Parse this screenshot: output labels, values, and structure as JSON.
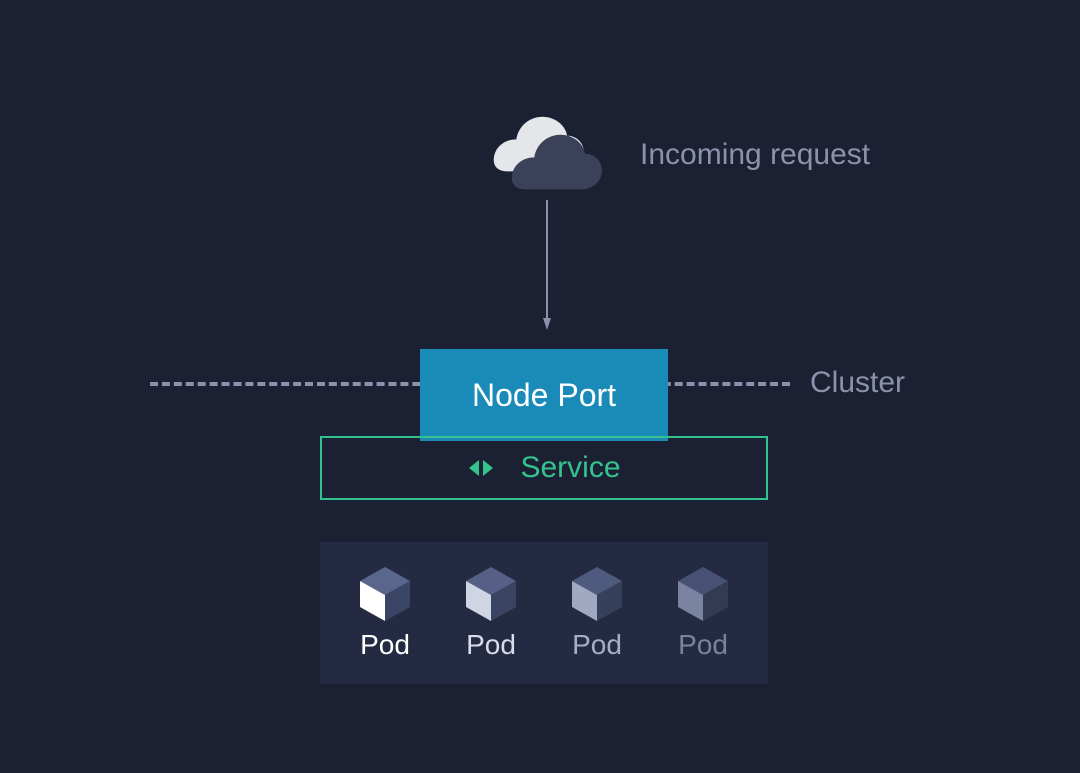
{
  "diagram": {
    "incoming_label": "Incoming request",
    "cluster_label": "Cluster",
    "nodeport_label": "Node Port",
    "service_label": "Service",
    "pods": [
      {
        "label": "Pod",
        "opacity": 1.0
      },
      {
        "label": "Pod",
        "opacity": 0.85
      },
      {
        "label": "Pod",
        "opacity": 0.65
      },
      {
        "label": "Pod",
        "opacity": 0.45
      }
    ],
    "colors": {
      "bg": "#1c2033",
      "muted": "#8b92ab",
      "nodeport": "#1a8bb9",
      "service": "#34c28e",
      "pod_panel": "#242a42"
    }
  }
}
